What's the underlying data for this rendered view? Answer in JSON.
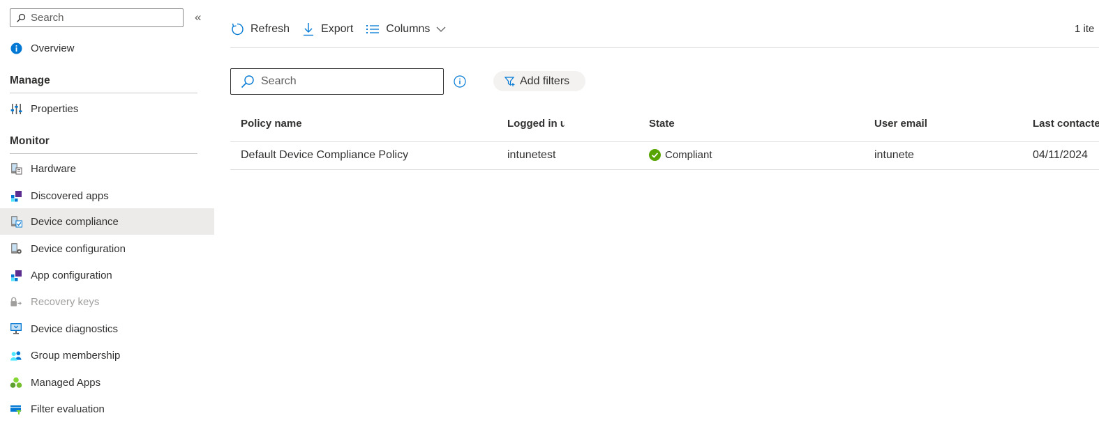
{
  "sidebar": {
    "search_placeholder": "Search",
    "collapse_glyph": "«",
    "overview": "Overview",
    "sections": {
      "manage": "Manage",
      "monitor": "Monitor"
    },
    "manage_items": [
      {
        "label": "Properties",
        "icon": "properties-icon"
      }
    ],
    "monitor_items": [
      {
        "label": "Hardware",
        "icon": "hardware-icon"
      },
      {
        "label": "Discovered apps",
        "icon": "discovered-apps-icon"
      },
      {
        "label": "Device compliance",
        "icon": "device-compliance-icon",
        "selected": true
      },
      {
        "label": "Device configuration",
        "icon": "device-configuration-icon"
      },
      {
        "label": "App configuration",
        "icon": "app-configuration-icon"
      },
      {
        "label": "Recovery keys",
        "icon": "recovery-keys-icon",
        "disabled": true
      },
      {
        "label": "Device diagnostics",
        "icon": "device-diagnostics-icon"
      },
      {
        "label": "Group membership",
        "icon": "group-membership-icon"
      },
      {
        "label": "Managed Apps",
        "icon": "managed-apps-icon"
      },
      {
        "label": "Filter evaluation",
        "icon": "filter-evaluation-icon"
      }
    ]
  },
  "toolbar": {
    "refresh": "Refresh",
    "export": "Export",
    "columns": "Columns",
    "item_count": "1 ite"
  },
  "filters": {
    "search_placeholder": "Search",
    "add_filters": "Add filters"
  },
  "table": {
    "columns": [
      "Policy name",
      "Logged in u",
      "State",
      "User email",
      "Last contacte"
    ],
    "rows": [
      {
        "policy_name": "Default Device Compliance Policy",
        "logged_in_user": "intunetest",
        "state": "Compliant",
        "user_email": "intunete",
        "last_contacted": "04/11/2024"
      }
    ]
  },
  "colors": {
    "accent": "#0078d4",
    "selected_bg": "#edebe9",
    "compliant": "#57a300",
    "purple": "#5c2d91"
  }
}
